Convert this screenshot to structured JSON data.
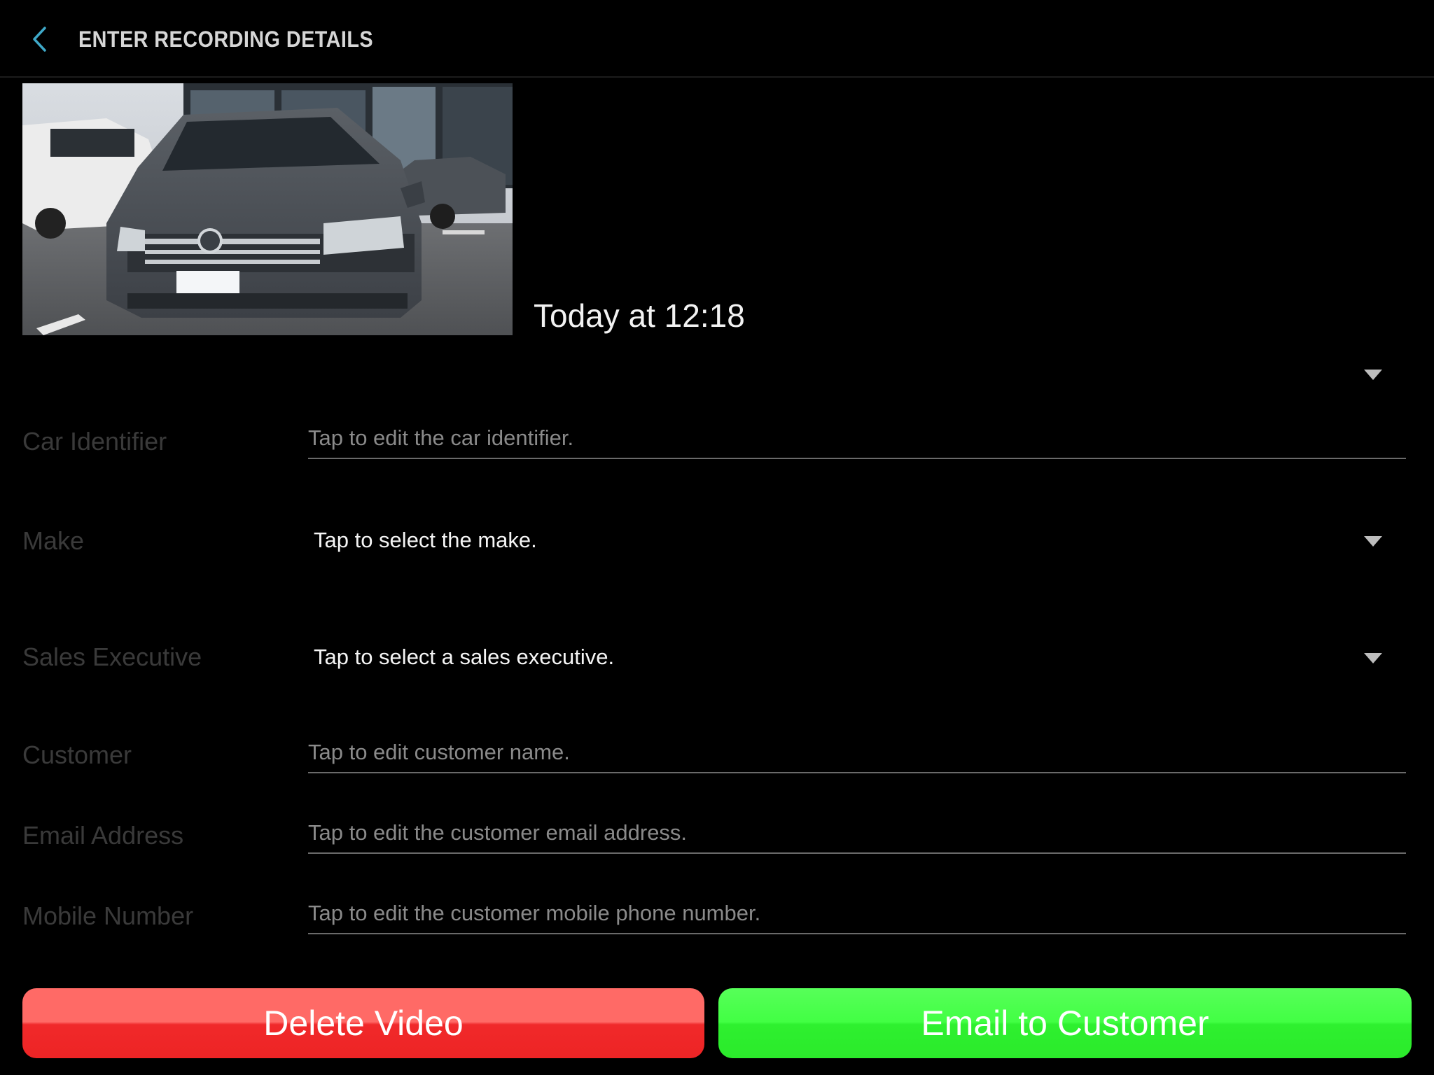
{
  "header": {
    "title": "ENTER RECORDING DETAILS",
    "back_icon": "chevron-left-icon",
    "accent_color": "#3fa9c9"
  },
  "recording": {
    "thumbnail_icon": "video-thumbnail-car",
    "timestamp": "Today at 12:18"
  },
  "form": {
    "car_identifier": {
      "label": "Car Identifier",
      "value": "",
      "placeholder": "Tap to edit the car identifier."
    },
    "make": {
      "label": "Make",
      "selected": "Tap to select the make."
    },
    "sales_executive": {
      "label": "Sales Executive",
      "selected": "Tap to select a sales executive."
    },
    "customer": {
      "label": "Customer",
      "value": "",
      "placeholder": "Tap to edit customer name."
    },
    "email": {
      "label": "Email Address",
      "value": "",
      "placeholder": "Tap to edit the customer email address."
    },
    "mobile": {
      "label": "Mobile Number",
      "value": "",
      "placeholder": "Tap to edit the customer mobile phone number."
    }
  },
  "actions": {
    "delete_label": "Delete Video",
    "email_label": "Email to Customer",
    "delete_color": "#f0292a",
    "email_color": "#2ef02f"
  }
}
